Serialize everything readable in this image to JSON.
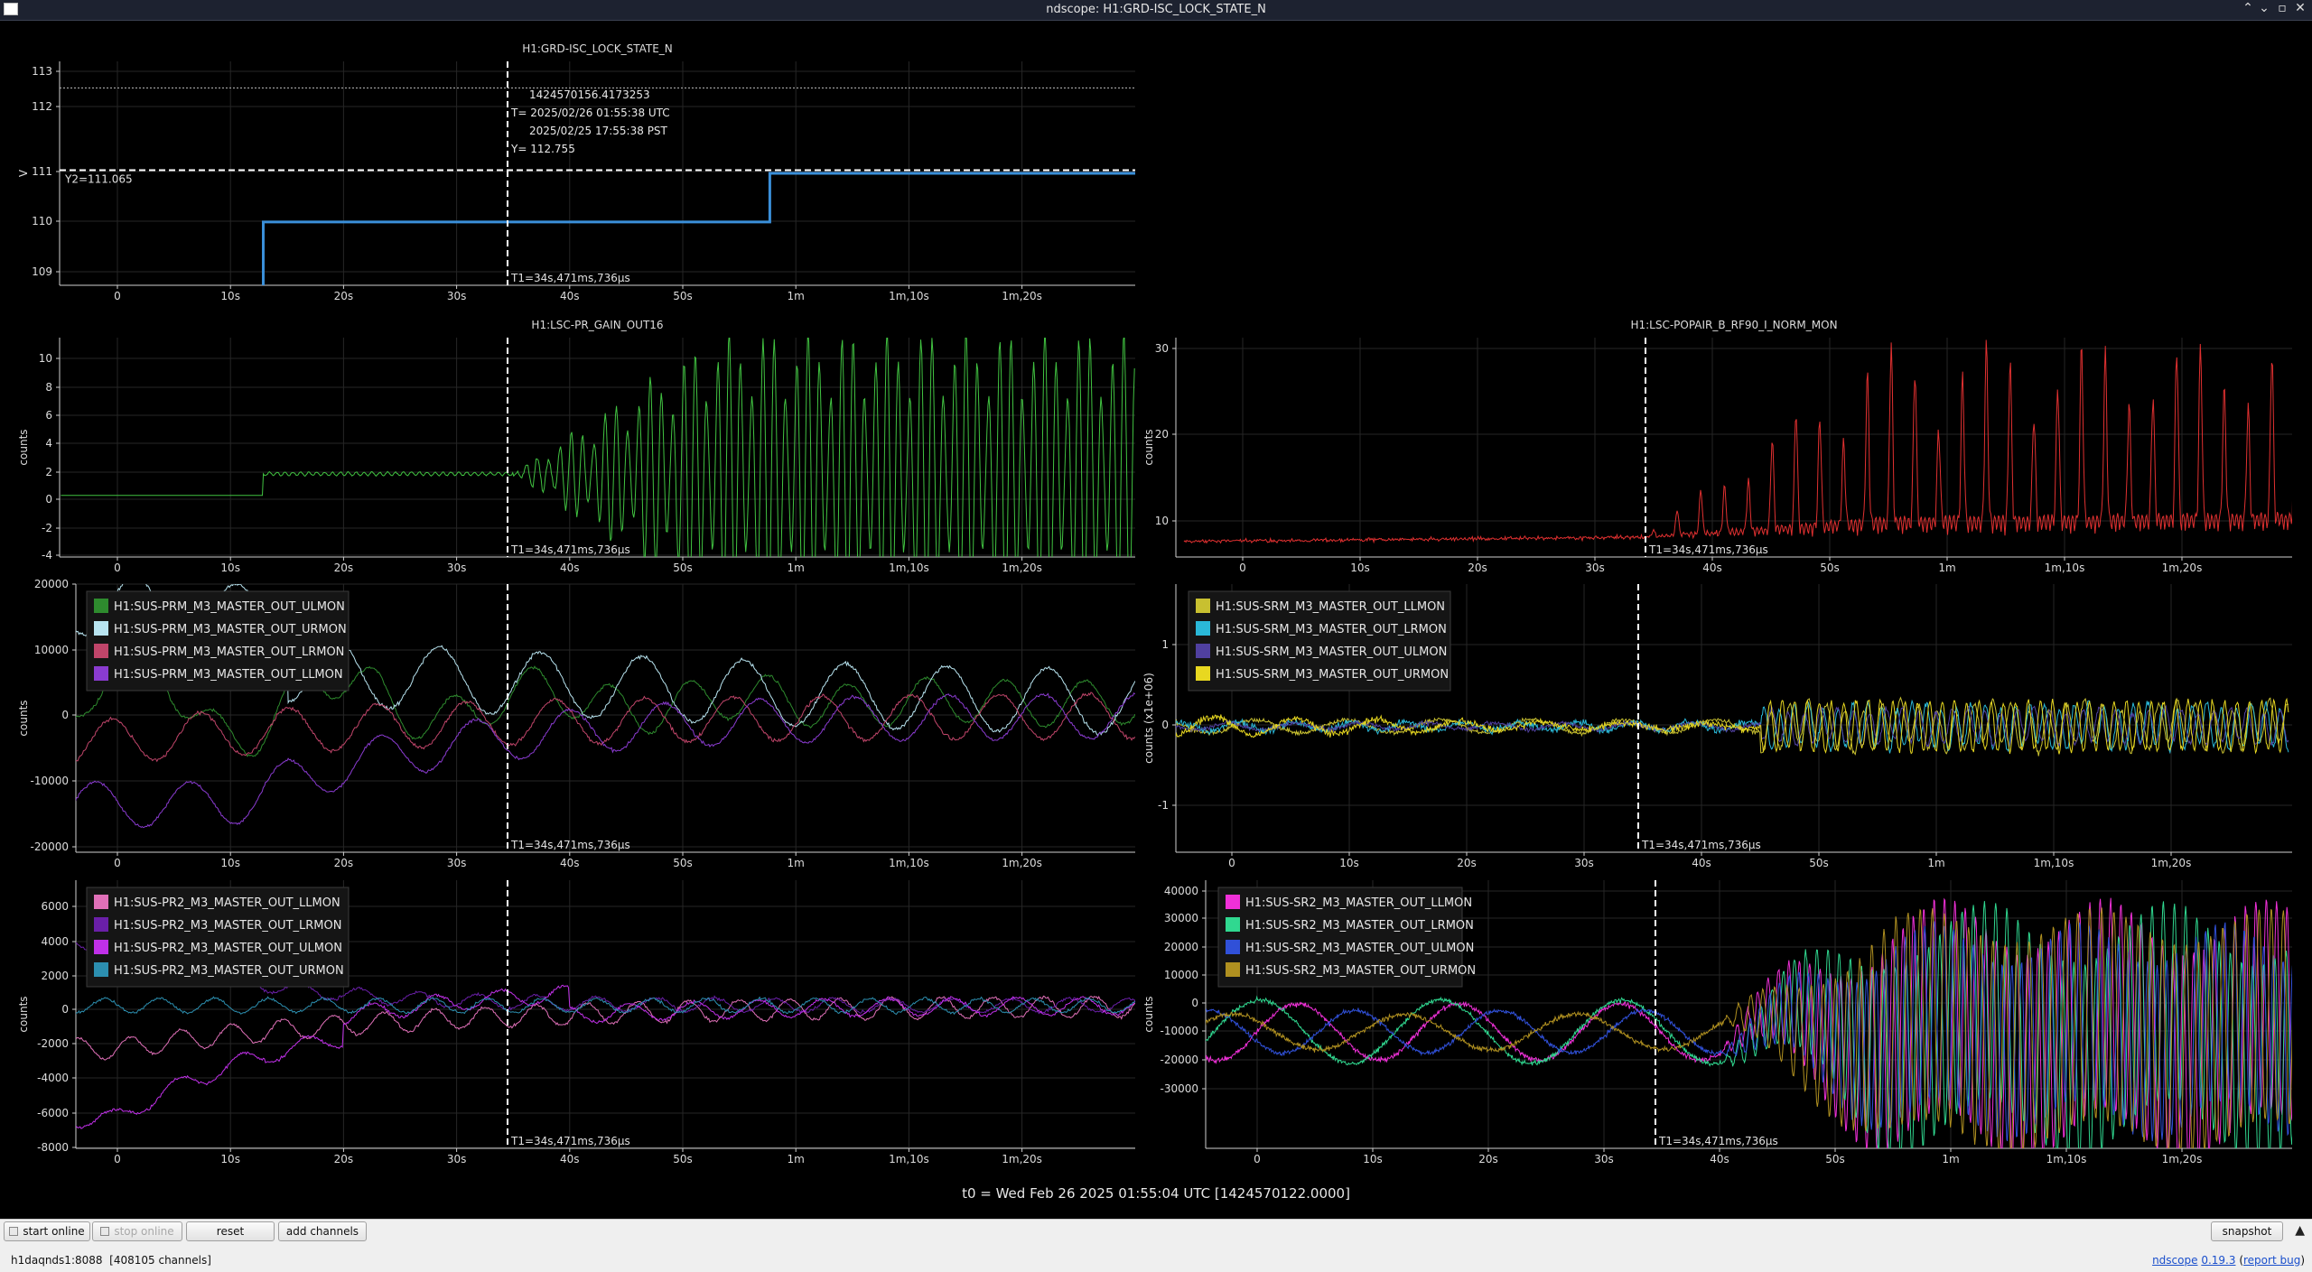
{
  "window": {
    "title": "ndscope: H1:GRD-ISC_LOCK_STATE_N"
  },
  "colors": {
    "background": "#000000",
    "grid": "#2b2b2b",
    "cursor": "#ffffff",
    "text": "#dcdcdc"
  },
  "t0_label": "t0 = Wed Feb 26 2025 01:55:04 UTC [1424570122.0000]",
  "cursor_label": "T1=34s,471ms,736µs",
  "toolbar": {
    "start_online": "start online",
    "stop_online": "stop online",
    "reset": "reset",
    "add_channels": "add channels",
    "snapshot": "snapshot"
  },
  "status": {
    "server": "h1daqnds1:8088",
    "channels": "[408105 channels]",
    "app_link": "ndscope",
    "version_link": "0.19.3",
    "report_bug": "report bug"
  },
  "plots": [
    {
      "id": "guardian",
      "title": "H1:GRD-ISC_LOCK_STATE_N",
      "ylabel": "V",
      "yticks": [
        "113",
        "112",
        "111",
        "110",
        "109"
      ],
      "xticks": [
        "0",
        "10s",
        "20s",
        "30s",
        "40s",
        "50s",
        "1m",
        "1m,10s",
        "1m,20s"
      ],
      "cursor_info": [
        "1424570156.4173253",
        "T= 2025/02/26 01:55:38 UTC",
        "2025/02/25 17:55:38 PST",
        "Y= 112.755"
      ],
      "y2_label": "Y2=111.065",
      "series": [
        {
          "name": "H1:GRD-ISC_LOCK_STATE_N",
          "color": "#3a8fd9"
        }
      ],
      "chart_data": {
        "type": "line",
        "ylim": [
          108.7,
          113.3
        ],
        "xlim": [
          -5,
          90
        ],
        "steps": [
          {
            "x": 12.9,
            "y": 110
          },
          {
            "x": 57.7,
            "y": 111
          }
        ],
        "y1_cursor": 112.755,
        "y2_cursor": 111.065,
        "t1_cursor": 34.47
      }
    },
    {
      "id": "pr-gain",
      "title": "H1:LSC-PR_GAIN_OUT16",
      "ylabel": "counts",
      "yticks": [
        "10",
        "8",
        "6",
        "4",
        "2",
        "0",
        "-2",
        "-4"
      ],
      "xticks": [
        "0",
        "10s",
        "20s",
        "30s",
        "40s",
        "50s",
        "1m",
        "1m,10s",
        "1m,20s"
      ],
      "series": [
        {
          "name": "H1:LSC-PR_GAIN_OUT16",
          "color": "#41c341"
        }
      ],
      "chart_data": {
        "type": "line",
        "ylim": [
          -4.3,
          11
        ],
        "xlim": [
          -5,
          90
        ],
        "baseline_before_step": 0,
        "level_after_step": 1.5,
        "step_x": 12.9,
        "oscillation_grows_from_x": 35
      }
    },
    {
      "id": "popair",
      "title": "H1:LSC-POPAIR_B_RF90_I_NORM_MON",
      "ylabel": "counts",
      "yticks": [
        "30",
        "20",
        "10"
      ],
      "xticks": [
        "0",
        "10s",
        "20s",
        "30s",
        "40s",
        "50s",
        "1m",
        "1m,10s",
        "1m,20s"
      ],
      "series": [
        {
          "name": "H1:LSC-POPAIR_B_RF90_I_NORM_MON",
          "color": "#e03030"
        }
      ],
      "chart_data": {
        "type": "line",
        "ylim": [
          6.5,
          31
        ],
        "xlim": [
          -5,
          90
        ],
        "baseline": 8.5,
        "peak_max": 29
      }
    },
    {
      "id": "prm",
      "ylabel": "counts",
      "yticks": [
        "20000",
        "10000",
        "0",
        "-10000",
        "-20000"
      ],
      "xticks": [
        "0",
        "10s",
        "20s",
        "30s",
        "40s",
        "50s",
        "1m",
        "1m,10s",
        "1m,20s"
      ],
      "legend": [
        {
          "label": "H1:SUS-PRM_M3_MASTER_OUT_ULMON",
          "color": "#2e8b2e"
        },
        {
          "label": "H1:SUS-PRM_M3_MASTER_OUT_URMON",
          "color": "#b8e4f0"
        },
        {
          "label": "H1:SUS-PRM_M3_MASTER_OUT_LRMON",
          "color": "#c0456a"
        },
        {
          "label": "H1:SUS-PRM_M3_MASTER_OUT_LLMON",
          "color": "#8a3bd0"
        }
      ],
      "chart_data": {
        "type": "line",
        "ylim": [
          -21500,
          20500
        ],
        "xlim": [
          -5,
          90
        ]
      }
    },
    {
      "id": "srm",
      "ylabel": "counts (x1e+06)",
      "yticks": [
        "1",
        "0",
        "-1"
      ],
      "xticks": [
        "0",
        "10s",
        "20s",
        "30s",
        "40s",
        "50s",
        "1m",
        "1m,10s",
        "1m,20s"
      ],
      "legend": [
        {
          "label": "H1:SUS-SRM_M3_MASTER_OUT_LLMON",
          "color": "#c8c030"
        },
        {
          "label": "H1:SUS-SRM_M3_MASTER_OUT_LRMON",
          "color": "#2ab8d8"
        },
        {
          "label": "H1:SUS-SRM_M3_MASTER_OUT_ULMON",
          "color": "#5040a0"
        },
        {
          "label": "H1:SUS-SRM_M3_MASTER_OUT_URMON",
          "color": "#e8d820"
        }
      ],
      "chart_data": {
        "type": "line",
        "ylim": [
          -1.55,
          1.75
        ],
        "xlim": [
          -5,
          90
        ]
      }
    },
    {
      "id": "pr2",
      "ylabel": "counts",
      "yticks": [
        "6000",
        "4000",
        "2000",
        "0",
        "-2000",
        "-4000",
        "-6000",
        "-8000"
      ],
      "xticks": [
        "0",
        "10s",
        "20s",
        "30s",
        "40s",
        "50s",
        "1m",
        "1m,10s",
        "1m,20s"
      ],
      "legend": [
        {
          "label": "H1:SUS-PR2_M3_MASTER_OUT_LLMON",
          "color": "#e070b8"
        },
        {
          "label": "H1:SUS-PR2_M3_MASTER_OUT_LRMON",
          "color": "#6a1fa8"
        },
        {
          "label": "H1:SUS-PR2_M3_MASTER_OUT_ULMON",
          "color": "#c030e8"
        },
        {
          "label": "H1:SUS-PR2_M3_MASTER_OUT_URMON",
          "color": "#2c8fb0"
        }
      ],
      "chart_data": {
        "type": "line",
        "ylim": [
          -8200,
          7200
        ],
        "xlim": [
          -5,
          90
        ]
      }
    },
    {
      "id": "sr2",
      "ylabel": "counts",
      "yticks": [
        "40000",
        "30000",
        "20000",
        "10000",
        "0",
        "-10000",
        "-20000",
        "-30000"
      ],
      "xticks": [
        "0",
        "10s",
        "20s",
        "30s",
        "40s",
        "50s",
        "1m",
        "1m,10s",
        "1m,20s"
      ],
      "legend": [
        {
          "label": "H1:SUS-SR2_M3_MASTER_OUT_LLMON",
          "color": "#f030d8"
        },
        {
          "label": "H1:SUS-SR2_M3_MASTER_OUT_LRMON",
          "color": "#30d890"
        },
        {
          "label": "H1:SUS-SR2_M3_MASTER_OUT_ULMON",
          "color": "#3050d8"
        },
        {
          "label": "H1:SUS-SR2_M3_MASTER_OUT_URMON",
          "color": "#b09020"
        }
      ],
      "chart_data": {
        "type": "line",
        "ylim": [
          -33000,
          43000
        ],
        "xlim": [
          -5,
          90
        ]
      }
    }
  ]
}
